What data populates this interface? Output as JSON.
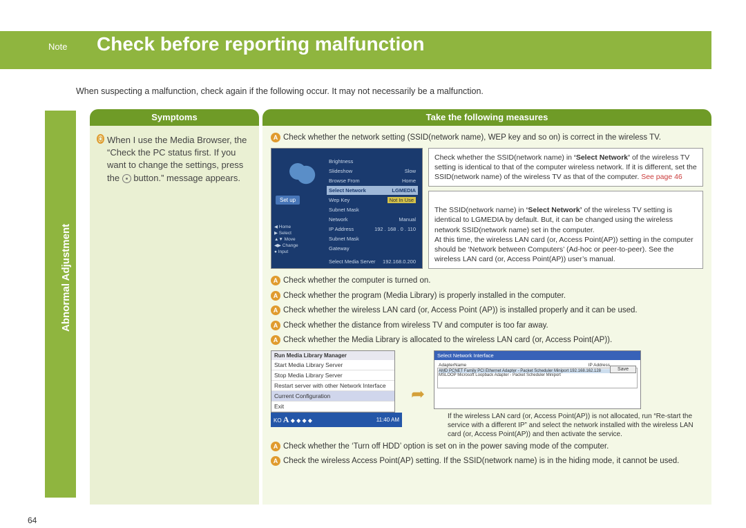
{
  "header": {
    "note": "Note",
    "title": "Check before reporting malfunction"
  },
  "intro": "When suspecting a malfunction, check again if the following occur. It may not necessarily be a malfunction.",
  "sidebar": {
    "label": "Abnormal Adjustment"
  },
  "columns": {
    "symptoms": "Symptoms",
    "measures": "Take the following measures"
  },
  "symptom": {
    "q": "Q",
    "line1": "When I use the Media Browser, the “Check the PC status first. If you want to change the settings, press the ",
    "line2": " button.” message appears."
  },
  "meas": {
    "a": "A",
    "m1": "Check whether the network setting (SSID(network name), WEP key and so on) is correct in the wireless TV.",
    "n1a": "Check whether the SSID(network name) in ",
    "n1b": "‘Select Network’",
    "n1c": " of the wireless TV setting is identical to that of the computer wireless network. If it is different, set the SSID(network name)  of the wireless TV as that of the computer. ",
    "n1d": "See page 46",
    "n2a": "The SSID(network name) in ",
    "n2b": "‘Select Network’",
    "n2c": " of the wireless TV setting is identical to LGMEDIA by default. But, it can be changed using the wireless   network SSID(network name) set in the computer.\nAt this time, the wireless LAN card (or, Access Point(AP)) setting in the computer should be ‘Network between Computers’ (Ad-hoc or peer-to-peer). See the wireless LAN card (or, Access Point(AP)) user’s manual.",
    "m2": "Check whether the computer is turned on.",
    "m3": "Check whether the program (Media Library) is properly installed in the computer.",
    "m4": "Check whether the wireless LAN card (or, Access Point (AP)) is installed properly and it can be used.",
    "m5": "Check whether the distance from wireless TV and computer is too far away.",
    "m6": "Check whether the Media Library is allocated to the wireless LAN card (or, Access Point(AP)).",
    "small": "If the wireless LAN card (or, Access Point(AP))  is not allocated, run “Re-start the service with a different IP” and select the network installed with the wireless LAN card (or, Access Point(AP))  and then activate the service.",
    "m7": "Check whether the ‘Turn off HDD’ option is set on in the power saving mode of the computer.",
    "m8": "Check the wireless Access Point(AP) setting. If the SSID(network name) is in the hiding mode, it cannot be used."
  },
  "tv": {
    "setup": "Set up",
    "items": [
      {
        "l": "Brightness",
        "r": ""
      },
      {
        "l": "Slideshow",
        "r": "Slow"
      },
      {
        "l": "Browse From",
        "r": "Home"
      },
      {
        "l": "Select Network",
        "r": "LGMEDIA"
      },
      {
        "l": "Wep Key",
        "r": "Not In Use"
      },
      {
        "l": "Subnet Mask",
        "r": ""
      },
      {
        "l": "Network",
        "r": "Manual"
      },
      {
        "l": "IP Address",
        "r": "192 . 168 . 0 . 110"
      },
      {
        "l": "Subnet Mask",
        "r": ""
      },
      {
        "l": "Gateway",
        "r": ""
      },
      {
        "l": "Select Media Server",
        "r": "192.168.0.200"
      }
    ],
    "nav": "◀ Home\n▶ Select\n▲▼ Move\n◀▶ Change\n● Input"
  },
  "ctx": {
    "head": "Run Media Library Manager",
    "items": [
      "Start Media Library Server",
      "Stop Media Library Server",
      "Restart server with other Network Interface",
      "Current Configuration",
      "Exit"
    ],
    "taskbar": {
      "lang": "KO",
      "a": "A",
      "time": "11:40 AM"
    }
  },
  "dlg": {
    "title": "Select Network Interface",
    "col1": "AdapterName",
    "col2": "IP Address",
    "r1": "AMD PCNET Family PCI Ethernet Adapter - Packet Scheduler Miniport      192.168.162.128",
    "r2": "MSLOOP Microsoft Loopback Adapter - Packet Scheduler Miniport",
    "btn": "Save"
  },
  "page": "64"
}
